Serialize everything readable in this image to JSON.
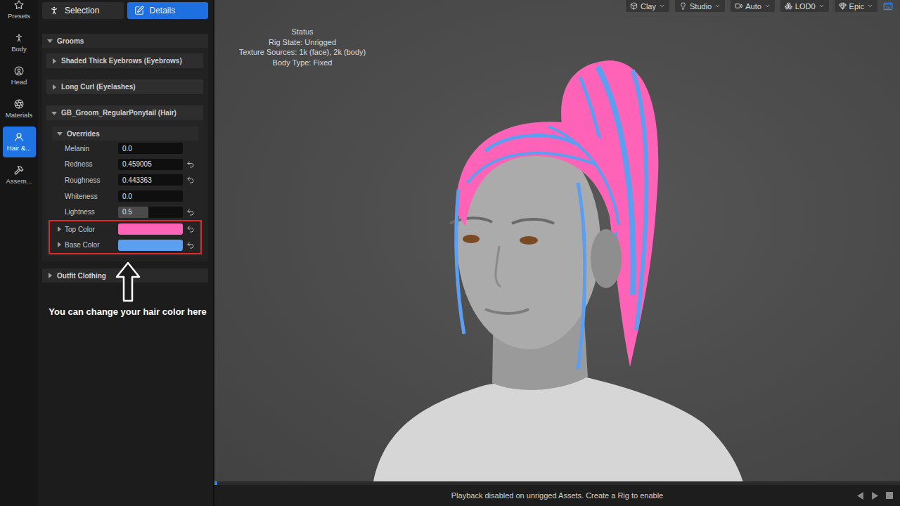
{
  "rail": {
    "items": [
      {
        "label": "Presets",
        "selected": false
      },
      {
        "label": "Body",
        "selected": false
      },
      {
        "label": "Head",
        "selected": false
      },
      {
        "label": "Materials",
        "selected": false
      },
      {
        "label": "Hair &...",
        "selected": true
      },
      {
        "label": "Assem...",
        "selected": false
      }
    ]
  },
  "panel": {
    "tabs": [
      {
        "label": "Selection",
        "selected": false
      },
      {
        "label": "Details",
        "selected": true
      }
    ],
    "sections": [
      {
        "title": "Grooms",
        "expanded": true,
        "items": [
          {
            "title": "Shaded Thick Eyebrows (Eyebrows)",
            "expanded": false
          },
          {
            "title": "Long Curl (Eyelashes)",
            "expanded": false
          },
          {
            "title": "GB_Groom_RegularPonytail (Hair)",
            "expanded": true,
            "overrides": {
              "title": "Overrides",
              "expanded": true,
              "rows": [
                {
                  "label": "Melanin",
                  "kind": "number",
                  "value": "0.0",
                  "reset": false,
                  "highlighted": false
                },
                {
                  "label": "Redness",
                  "kind": "number",
                  "value": "0.459005",
                  "reset": true,
                  "highlighted": false
                },
                {
                  "label": "Roughness",
                  "kind": "number",
                  "value": "0.443363",
                  "reset": true,
                  "highlighted": false
                },
                {
                  "label": "Whiteness",
                  "kind": "number",
                  "value": "0.0",
                  "reset": false,
                  "highlighted": false
                },
                {
                  "label": "Lightness",
                  "kind": "slider",
                  "value": "0.5",
                  "level": 0.47,
                  "reset": true,
                  "highlighted": false
                },
                {
                  "label": "Top Color",
                  "kind": "color",
                  "color": "#ff63b8",
                  "expanded": false,
                  "reset": true,
                  "highlighted": true
                },
                {
                  "label": "Base Color",
                  "kind": "color",
                  "color": "#5c9ef0",
                  "expanded": false,
                  "reset": true,
                  "highlighted": true
                }
              ]
            }
          }
        ]
      },
      {
        "title": "Outfit Clothing",
        "expanded": false,
        "items": []
      }
    ]
  },
  "annotation": {
    "text": "You can change your hair color here"
  },
  "viewport": {
    "toolbar": [
      {
        "label": "Clay"
      },
      {
        "label": "Studio"
      },
      {
        "label": "Auto"
      },
      {
        "label": "LOD0"
      },
      {
        "label": "Epic"
      }
    ],
    "status": {
      "title": "Status",
      "lines": [
        "Rig State: Unrigged",
        "Texture Sources: 1k (face), 2k (body)",
        "Body Type: Fixed"
      ]
    }
  },
  "playback": {
    "message": "Playback disabled on unrigged Assets. Create a Rig to enable",
    "level": 0
  }
}
